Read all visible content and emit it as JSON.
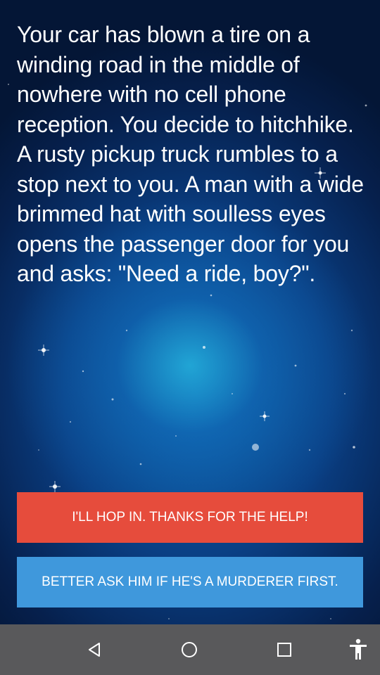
{
  "story": {
    "text": "Your car has blown a tire on a winding road in the middle of nowhere with no cell phone reception. You decide to hitchhike. A rusty pickup truck rumbles to a stop next to you. A man with a wide brimmed hat with soulless eyes opens the passenger door for you and asks: \"Need a ride, boy?\"."
  },
  "choices": [
    {
      "label": "I'll hop in. Thanks for the help!",
      "color": "#e64c3c"
    },
    {
      "label": "Better ask him if he's a murderer first.",
      "color": "#3f98dc"
    }
  ],
  "navbar": {
    "background": "#59595b",
    "icons": [
      "back-icon",
      "home-icon",
      "recents-icon",
      "accessibility-icon"
    ]
  },
  "colors": {
    "background_dark": "#06204d",
    "background_glow": "#28bee6",
    "text": "#ffffff"
  }
}
